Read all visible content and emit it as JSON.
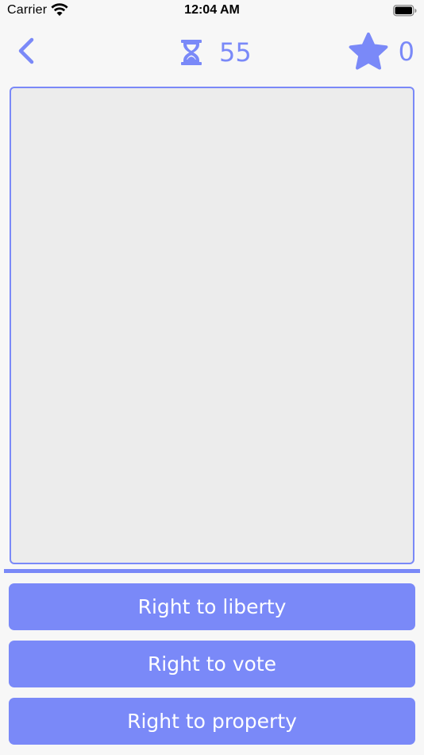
{
  "status_bar": {
    "carrier": "Carrier",
    "time": "12:04 AM",
    "icons": [
      "wifi-icon",
      "battery-icon"
    ]
  },
  "nav": {
    "back_icon": "chevron-left-icon",
    "timer_icon": "hourglass-icon",
    "timer_value": "55",
    "score_icon": "star-icon",
    "score_value": "0"
  },
  "answers": [
    {
      "label": "Right to liberty"
    },
    {
      "label": "Right to vote"
    },
    {
      "label": "Right to property"
    }
  ],
  "colors": {
    "accent": "#7a89f8",
    "background": "#f7f7f7",
    "panel": "#ececec"
  }
}
